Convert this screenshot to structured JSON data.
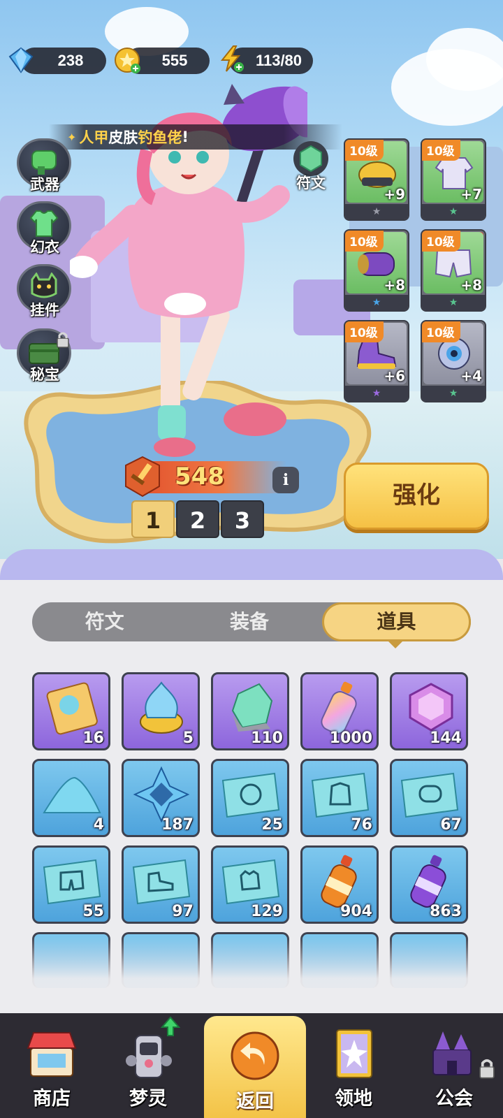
{
  "currency": {
    "gems": "238",
    "coins": "555",
    "energy": "113/80"
  },
  "banner": {
    "prefix": "人甲",
    "middle": "皮肤",
    "highlight": "钓鱼佬",
    "suffix": "!"
  },
  "side_menu": {
    "weapon": "武器",
    "outfit": "幻衣",
    "pendant": "挂件",
    "treasure": "秘宝"
  },
  "rune_button": "符文",
  "equipment": [
    {
      "level": "10级",
      "bonus": "+9",
      "rarity_color": "#9a9ca8"
    },
    {
      "level": "10级",
      "bonus": "+7",
      "rarity_color": "#59c48f"
    },
    {
      "level": "10级",
      "bonus": "+8",
      "rarity_color": "#4aa4e8"
    },
    {
      "level": "10级",
      "bonus": "+8",
      "rarity_color": "#59c48f"
    },
    {
      "level": "10级",
      "bonus": "+6",
      "rarity_color": "#9b6ae0"
    },
    {
      "level": "10级",
      "bonus": "+4",
      "rarity_color": "#59c48f"
    }
  ],
  "alert_mark": "!",
  "power": "548",
  "info_label": "i",
  "pages": [
    "1",
    "2",
    "3"
  ],
  "enhance_label": "强化",
  "tabs": [
    "符文",
    "装备",
    "道具"
  ],
  "items": [
    {
      "count": "16",
      "icon": "ticket-icon"
    },
    {
      "count": "5",
      "icon": "blue-flame-orb-icon"
    },
    {
      "count": "110",
      "icon": "green-crystal-icon"
    },
    {
      "count": "1000",
      "icon": "rainbow-bottle-icon"
    },
    {
      "count": "144",
      "icon": "purple-gem-icon"
    },
    {
      "count": "4",
      "icon": "blue-powder-icon"
    },
    {
      "count": "187",
      "icon": "blue-star-crystal-icon"
    },
    {
      "count": "25",
      "icon": "helmet-blueprint-icon"
    },
    {
      "count": "76",
      "icon": "jacket-blueprint-icon"
    },
    {
      "count": "67",
      "icon": "armguard-blueprint-icon"
    },
    {
      "count": "55",
      "icon": "shorts-blueprint-icon"
    },
    {
      "count": "97",
      "icon": "shoe-blueprint-icon"
    },
    {
      "count": "129",
      "icon": "glove-blueprint-icon"
    },
    {
      "count": "904",
      "icon": "orange-bottle-icon"
    },
    {
      "count": "863",
      "icon": "purple-bottle-icon"
    }
  ],
  "nav": {
    "shop": "商店",
    "spirit": "梦灵",
    "back": "返回",
    "territory": "领地",
    "guild": "公会"
  }
}
